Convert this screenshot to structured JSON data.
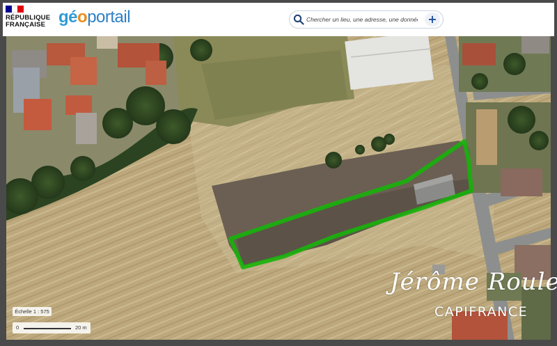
{
  "header": {
    "republic_line1": "RÉPUBLIQUE",
    "republic_line2": "FRANÇAISE",
    "logo": {
      "part1": "gé",
      "part2": "o",
      "part3": "portail"
    },
    "flag_colors": [
      "#000091",
      "#ffffff",
      "#e1000f"
    ]
  },
  "search": {
    "placeholder": "Chercher un lieu, une adresse, une donnée",
    "value": "",
    "icon": "magnifier-icon",
    "add_icon": "plus-icon",
    "add_label": "+"
  },
  "scale": {
    "label": "Échelle 1 : 575",
    "zero": "0",
    "distance": "20 m"
  },
  "watermark": {
    "name": "Jérôme Roulet",
    "brand": "CAPIFRANCE"
  },
  "colors": {
    "parcel_outline": "#17b30a",
    "header_bg": "#ffffff",
    "logo_blue": "#2e9bd6",
    "logo_orange": "#e88d1b"
  }
}
